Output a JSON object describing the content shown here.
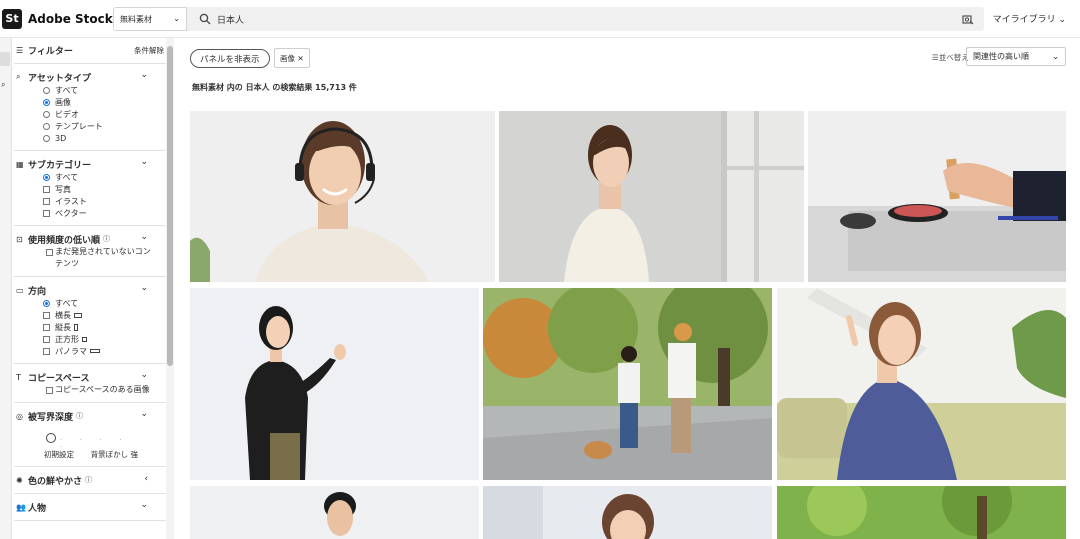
{
  "header": {
    "logo_badge": "St",
    "logo_text": "Adobe Stock",
    "scope_label": "無料素材",
    "search_value": "日本人",
    "library_label": "マイライブラリ"
  },
  "filter_panel": {
    "title": "フィルター",
    "clear_label": "条件解除",
    "asset_type": {
      "title": "アセットタイプ",
      "options": [
        "すべて",
        "画像",
        "ビデオ",
        "テンプレート",
        "3D"
      ],
      "selected": "画像"
    },
    "subcategory": {
      "title": "サブカテゴリー",
      "options": [
        "すべて",
        "写真",
        "イラスト",
        "ベクター"
      ],
      "selected": "すべて"
    },
    "low_usage": {
      "title": "使用頻度の低い順",
      "option": "まだ発見されていないコンテンツ"
    },
    "orientation": {
      "title": "方向",
      "options": [
        "すべて",
        "横長",
        "縦長",
        "正方形",
        "パノラマ"
      ],
      "selected": "すべて"
    },
    "copy_space": {
      "title": "コピースペース",
      "option": "コピースペースのある画像"
    },
    "depth_of_field": {
      "title": "被写界深度",
      "label_left": "初期設定",
      "label_right": "背景ぼかし 強"
    },
    "color_vividness": {
      "title": "色の鮮やかさ"
    },
    "people": {
      "title": "人物"
    }
  },
  "toolbar": {
    "hide_panel_label": "パネルを非表示",
    "chip_label": "画像",
    "sort_label": "並べ替え",
    "sort_value": "関連性の高い順"
  },
  "results": {
    "summary": "無料素材 内の 日本人 の検索結果 15,713 件"
  },
  "colors": {
    "accent": "#1473e6",
    "brand": "#1a1a1a"
  }
}
